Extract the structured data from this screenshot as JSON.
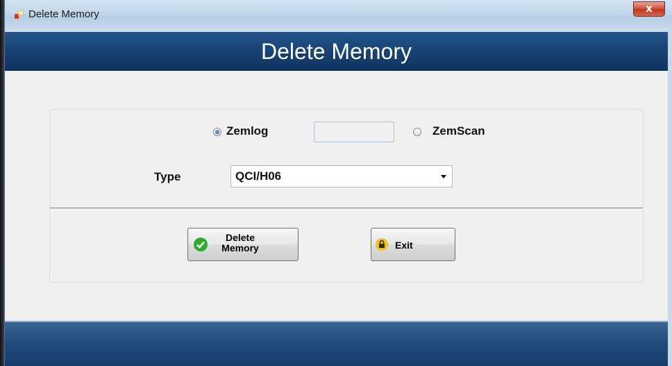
{
  "window": {
    "title": "Delete Memory",
    "close_glyph": "x"
  },
  "header": {
    "title": "Delete Memory"
  },
  "form": {
    "radio_zemlog": {
      "label": "Zemlog",
      "checked": true
    },
    "radio_zemscan": {
      "label": "ZemScan",
      "checked": false
    },
    "text_box": {
      "value": ""
    },
    "type_label": "Type",
    "type_select": {
      "value": "QCI/H06"
    }
  },
  "buttons": {
    "delete": {
      "line1": "Delete",
      "line2": "Memory",
      "icon": "check-circle-icon"
    },
    "exit": {
      "label": "Exit",
      "icon": "lock-icon"
    }
  },
  "colors": {
    "header_blue": "#16406f",
    "check_green": "#2faa2f",
    "lock_yellow": "#f3c21a"
  }
}
